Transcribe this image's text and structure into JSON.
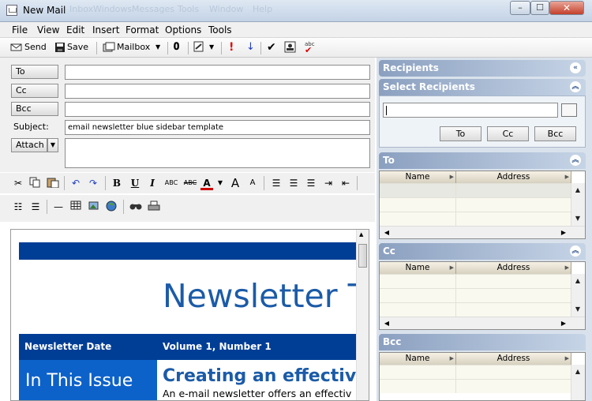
{
  "window": {
    "title": "New Mail",
    "ghost_titles": [
      "Inbox",
      "Windows",
      "Messages",
      "Tools",
      "Window",
      "Help"
    ],
    "buttons": [
      "–",
      "☐",
      "✕"
    ]
  },
  "menu": [
    "File",
    "View",
    "Edit",
    "Insert",
    "Format",
    "Options",
    "Tools"
  ],
  "toolbar": {
    "send": "Send",
    "save": "Save",
    "mailbox": "Mailbox"
  },
  "header": {
    "to_label": "To",
    "cc_label": "Cc",
    "bcc_label": "Bcc",
    "subject_label": "Subject:",
    "subject_value": "email newsletter blue sidebar template",
    "attach_label": "Attach",
    "to_value": "",
    "cc_value": "",
    "bcc_value": ""
  },
  "format": {
    "bold": "B",
    "underline": "U",
    "italic": "I",
    "super": "ABC",
    "strike": "ABC",
    "fontcolor": "A",
    "grow": "A",
    "shrink": "A"
  },
  "newsletter": {
    "title": "Newsletter T",
    "date_label": "Newsletter Date",
    "volume": "Volume 1, Number 1",
    "sidebar_title": "In This Issue",
    "headline": "Creating an effective e",
    "body": "An e-mail newsletter offers an effectiv"
  },
  "recipients": {
    "title": "Recipients",
    "select_title": "Select Recipients",
    "search_value": "",
    "btn_to": "To",
    "btn_cc": "Cc",
    "btn_bcc": "Bcc",
    "sections": [
      {
        "title": "To",
        "col_name": "Name",
        "col_address": "Address"
      },
      {
        "title": "Cc",
        "col_name": "Name",
        "col_address": "Address"
      },
      {
        "title": "Bcc",
        "col_name": "Name",
        "col_address": "Address"
      }
    ]
  },
  "icons": {
    "accent": "#003e96",
    "link_blue": "#1b5ba8",
    "panel_header": "#8ba0c0"
  }
}
